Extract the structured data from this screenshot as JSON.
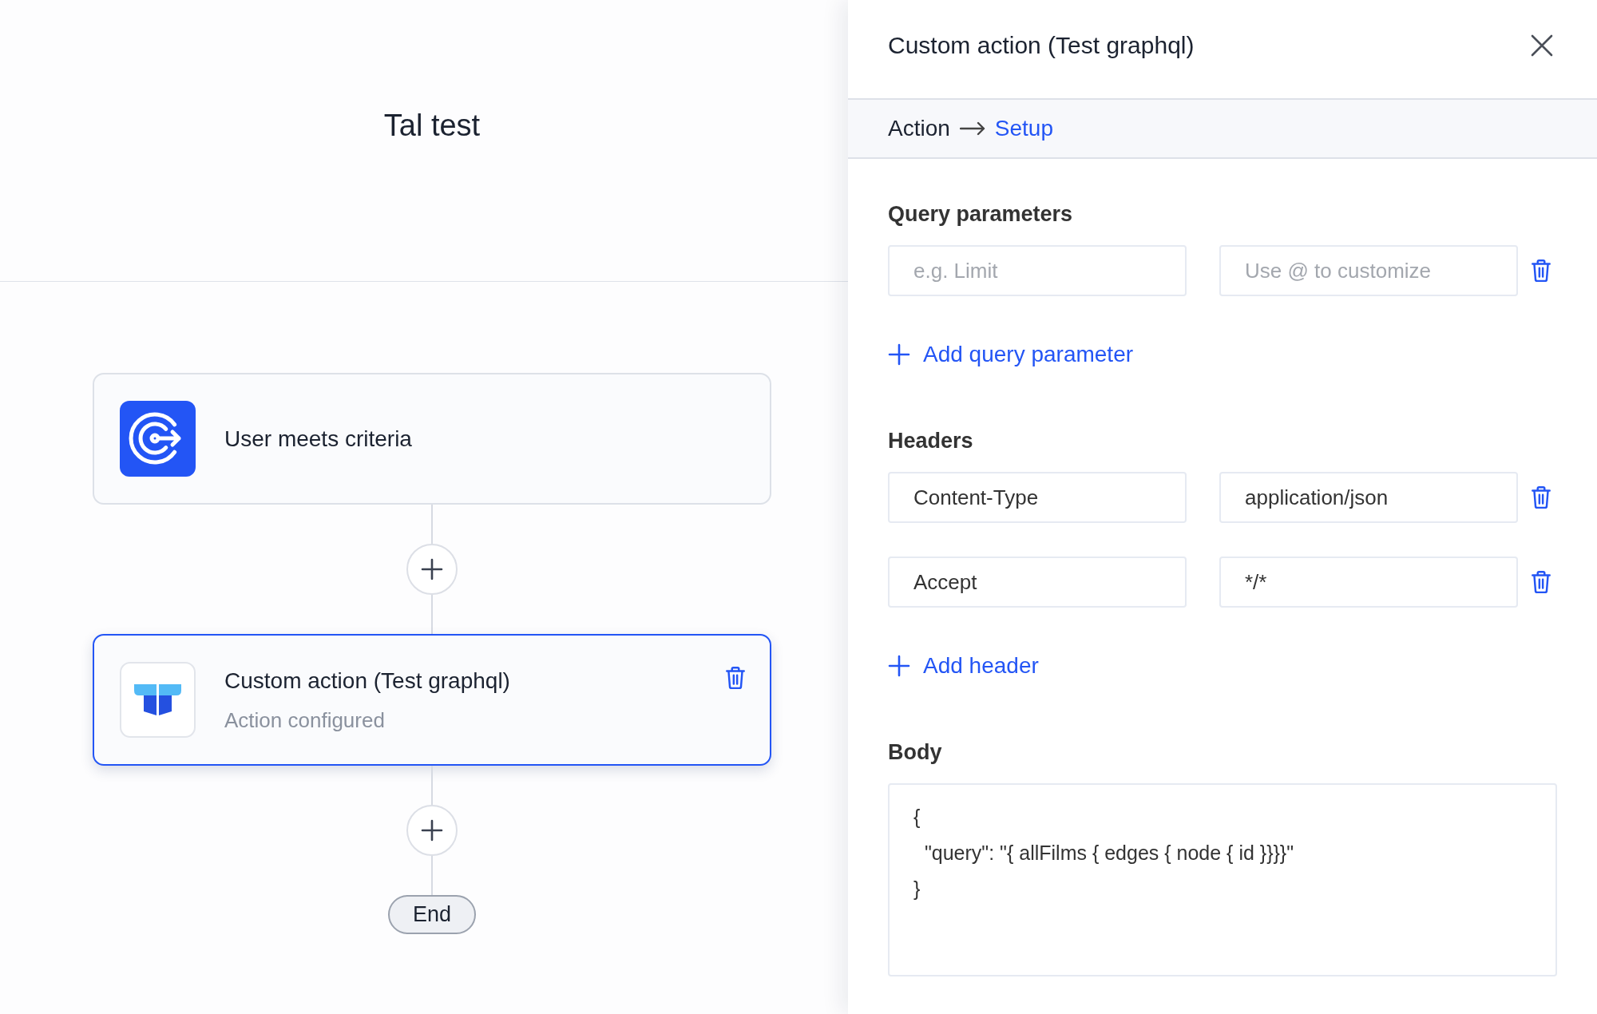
{
  "canvas": {
    "title": "Tal test",
    "nodes": [
      {
        "kind": "trigger",
        "title": "User meets criteria",
        "selected": false
      },
      {
        "kind": "action",
        "title": "Custom action (Test graphql)",
        "subtitle": "Action configured",
        "selected": true
      }
    ],
    "end_label": "End"
  },
  "panel": {
    "title": "Custom action (Test graphql)",
    "breadcrumb": [
      {
        "label": "Action",
        "selected": false
      },
      {
        "label": "Setup",
        "selected": true
      }
    ],
    "query_parameters": {
      "heading": "Query parameters",
      "rows": [
        {
          "key": {
            "placeholder": "e.g. Limit"
          },
          "value": {
            "placeholder": "Use @ to customize"
          }
        }
      ],
      "add_label": "Add query parameter"
    },
    "headers": {
      "heading": "Headers",
      "rows": [
        {
          "key": {
            "value": "Content-Type"
          },
          "value": {
            "value": "application/json"
          }
        },
        {
          "key": {
            "value": "Accept"
          },
          "value": {
            "value": "*/*"
          }
        }
      ],
      "add_label": "Add header"
    },
    "body": {
      "heading": "Body",
      "value": "{\n  \"query\": \"{ allFilms { edges { node { id }}}}\"\n}"
    }
  }
}
